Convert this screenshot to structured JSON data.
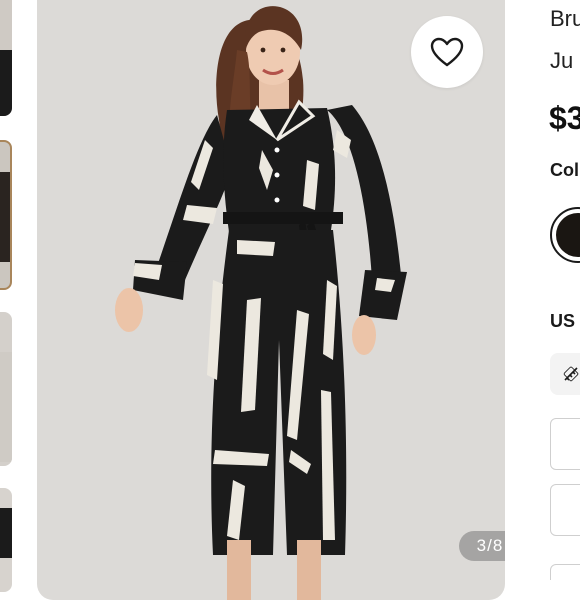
{
  "product": {
    "title_line_1": "Bru",
    "title_line_2": "Ju",
    "price": "$3"
  },
  "gallery": {
    "counter": "3/8",
    "thumbnails": [
      "thumb-1",
      "thumb-2",
      "thumb-3",
      "thumb-4"
    ],
    "selected_thumbnail": 2
  },
  "wishlist": {
    "icon": "heart-outline-icon"
  },
  "options": {
    "color_label": "Col",
    "selected_color": "#1a1612",
    "size_label": "US",
    "size_guide_icon": "ruler-icon",
    "size_options": [
      "",
      "",
      ""
    ]
  },
  "colors": {
    "background": "#ffffff",
    "image_backdrop": "#dcdad7",
    "accent_border": "#a9865b",
    "jumpsuit_black": "#1b1b1b",
    "jumpsuit_print": "#ece8df"
  }
}
